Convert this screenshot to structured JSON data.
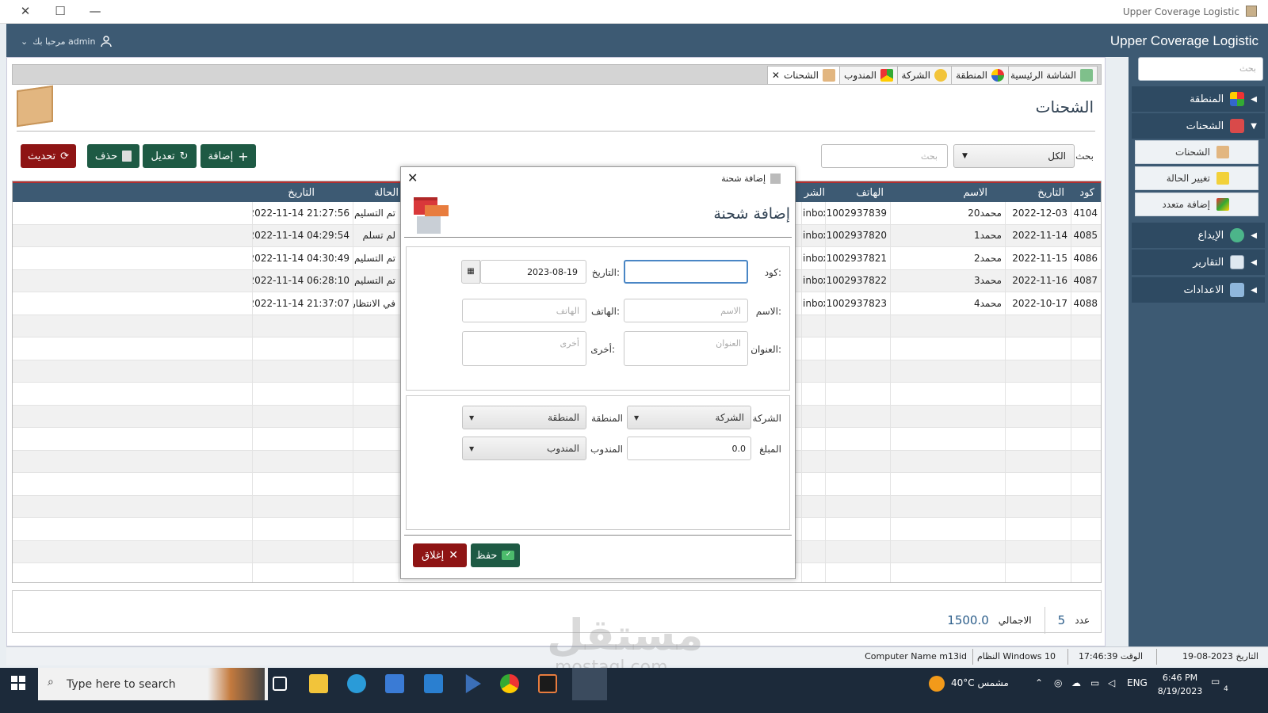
{
  "window": {
    "title": "Upper Coverage Logistic",
    "close": "✕",
    "maximize": "☐",
    "minimize": "—"
  },
  "header": {
    "brand": "Upper Coverage Logistic",
    "user_greeting": "مرحبا بك admin"
  },
  "sidebar": {
    "search_placeholder": "بحث",
    "items": [
      {
        "label": "المنطقة",
        "arrow": "◀"
      },
      {
        "label": "الشحنات",
        "arrow": "▼"
      },
      {
        "label": "الإيداع",
        "arrow": "◀"
      },
      {
        "label": "التقارير",
        "arrow": "◀"
      },
      {
        "label": "الاعدادات",
        "arrow": "◀"
      }
    ],
    "subitems": [
      {
        "label": "الشحنات"
      },
      {
        "label": "تغيير الحالة"
      },
      {
        "label": "إضافة متعدد"
      }
    ]
  },
  "tabs": [
    {
      "label": "الشاشة الرئيسية"
    },
    {
      "label": "المنطقة"
    },
    {
      "label": "الشركة"
    },
    {
      "label": "المندوب"
    },
    {
      "label": "الشحنات",
      "close": "✕"
    }
  ],
  "page": {
    "title": "الشحنات"
  },
  "toolbar": {
    "add": "إضافة",
    "edit": "تعديل",
    "delete": "حذف",
    "refresh": "تحديث",
    "search_label": "بحث",
    "filter_value": "الكل",
    "search_placeholder": "بحث"
  },
  "table": {
    "columns": [
      "كود",
      "التاريخ",
      "الاسم",
      "الهاتف",
      "الشر",
      "الحالة",
      "التاريخ"
    ],
    "rows": [
      [
        "4104",
        "2022-12-03",
        "محمد20",
        "1002937839",
        "inbox",
        "تم التسليم",
        "2022-11-14 21:27:56"
      ],
      [
        "4085",
        "2022-11-14",
        "محمد1",
        "1002937820",
        "inbox",
        "لم تسلم",
        "2022-11-14 04:29:54"
      ],
      [
        "4086",
        "2022-11-15",
        "محمد2",
        "1002937821",
        "inbox",
        "تم التسليم",
        "2022-11-14 04:30:49"
      ],
      [
        "4087",
        "2022-11-16",
        "محمد3",
        "1002937822",
        "inbox",
        "تم التسليم",
        "2022-11-14 06:28:10"
      ],
      [
        "4088",
        "2022-10-17",
        "محمد4",
        "1002937823",
        "inbox",
        "في الانتظار",
        "2022-11-14 21:37:07"
      ]
    ]
  },
  "summary": {
    "count_label": "عدد",
    "count": "5",
    "total_label": "الاجمالي",
    "total": "1500.0"
  },
  "status": {
    "date_label": "التاريخ",
    "date": "2023-08-19",
    "time_label": "الوقت",
    "time": "17:46:39",
    "os_label": "النظام",
    "os": "Windows 10",
    "computer_label": "Computer Name",
    "computer": "m13id"
  },
  "dialog": {
    "window_title": "إضافة شحنة",
    "heading": "إضافة شحنة",
    "code_label": "كود:",
    "date_label": "التاريخ:",
    "date_value": "2023-08-19",
    "name_label": "الاسم:",
    "name_placeholder": "الاسم",
    "phone_label": "الهاتف:",
    "phone_placeholder": "الهاتف",
    "address_label": "العنوان:",
    "address_placeholder": "العنوان",
    "other_label": "أخرى:",
    "other_placeholder": "أخرى",
    "company_label": "الشركة",
    "company_value": "الشركة",
    "region_label": "المنطقة",
    "region_value": "المنطقة",
    "amount_label": "المبلغ",
    "amount_value": "0.0",
    "agent_label": "المندوب",
    "agent_value": "المندوب",
    "save": "حفظ",
    "close": "إغلاق"
  },
  "taskbar": {
    "search_placeholder": "Type here to search",
    "weather": "40°C  مشمس",
    "lang": "ENG",
    "time": "6:46 PM",
    "date": "8/19/2023",
    "notifications": "4"
  },
  "watermark": {
    "text": "مستقل",
    "sub": "mostaql.com"
  }
}
